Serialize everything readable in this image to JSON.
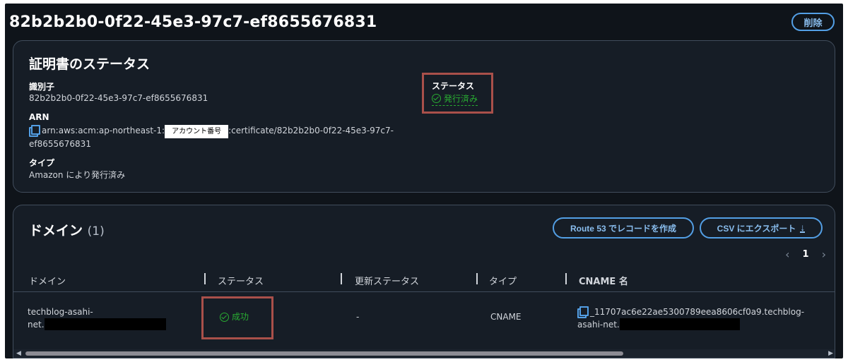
{
  "header": {
    "title": "82b2b2b0-0f22-45e3-97c7-ef8655676831",
    "delete_label": "削除"
  },
  "certificate_status": {
    "heading": "証明書のステータス",
    "identifier_label": "識別子",
    "identifier_value": "82b2b2b0-0f22-45e3-97c7-ef8655676831",
    "arn_label": "ARN",
    "arn_prefix": "arn:aws:acm:ap-northeast-1:",
    "arn_account_placeholder": "アカウント番号",
    "arn_suffix_line1": ":certificate/82b2b2b0-0f22-45e3-97c7-",
    "arn_suffix_line2": "ef8655676831",
    "type_label": "タイプ",
    "type_value": "Amazon により発行済み",
    "status_label": "ステータス",
    "status_value": "発行済み"
  },
  "domains": {
    "heading": "ドメイン",
    "count": "(1)",
    "route53_button": "Route 53 でレコードを作成",
    "csv_button": "CSV にエクスポート",
    "pager": {
      "prev": "‹",
      "page": "1",
      "next": "›"
    },
    "columns": [
      "ドメイン",
      "ステータス",
      "更新ステータス",
      "タイプ",
      "CNAME 名"
    ],
    "rows": [
      {
        "domain_line1": "techblog-asahi-",
        "domain_line2": "net.",
        "status": "成功",
        "renewal_status": "-",
        "type": "CNAME",
        "cname_line1": "_11707ac6e22ae5300789eea8606cf0a9.techblog-",
        "cname_line2": "asahi-net."
      }
    ]
  },
  "icons": {
    "copy": "copy-icon",
    "status_check": "check-circle-icon",
    "download": "download-icon",
    "scroll_left": "◀",
    "scroll_right": "▶"
  },
  "colors": {
    "background": "#0f141a",
    "panel": "#161d26",
    "accent_blue": "#539fe5",
    "success_green": "#29ad32",
    "highlight_red": "#a9504a"
  }
}
